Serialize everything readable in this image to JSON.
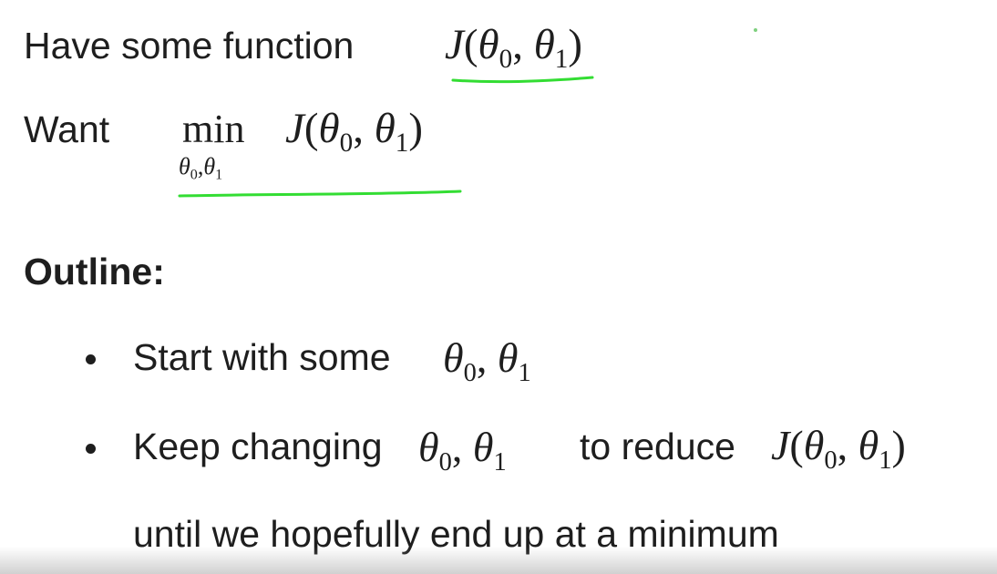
{
  "slide": {
    "line1": {
      "text": "Have some function",
      "math": "J(θ₀, θ₁)"
    },
    "line2": {
      "text": "Want",
      "operator": "min",
      "operator_sub": "θ₀,θ₁",
      "math": "J(θ₀, θ₁)"
    },
    "outline_heading": "Outline:",
    "bullets": [
      {
        "text": "Start with some",
        "math": "θ₀, θ₁"
      },
      {
        "text_before": "Keep changing",
        "math_before": "θ₀, θ₁",
        "text_middle": "to reduce",
        "math_after": "J(θ₀, θ₁)",
        "continuation": "until we hopefully end up at a minimum"
      }
    ]
  },
  "annotation_color": "#33dd33",
  "text_color": "#1e1e1e",
  "background_color": "#ffffff"
}
